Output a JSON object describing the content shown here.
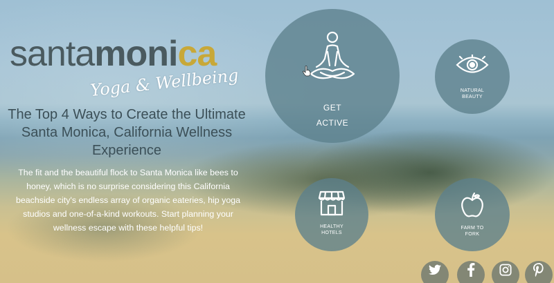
{
  "brand": {
    "logo_santa": "santa",
    "logo_moni": "moni",
    "logo_ca": "ca",
    "tagline": "Yoga & Wellbeing",
    "colors": {
      "logo_gray": "#4a5a5f",
      "logo_gold": "#c8a838"
    }
  },
  "headline": "The Top 4 Ways to Create the Ultimate Santa Monica, California Wellness Experience",
  "intro": "The fit and the beautiful flock to Santa Monica like bees to honey, which is no surprise considering this California beachside city's endless array of organic eateries, hip yoga studios and one-of-a-kind workouts. Start planning your wellness escape with these helpful tips!",
  "circles": {
    "get_active": {
      "line1": "GET",
      "line2": "ACTIVE",
      "icon": "meditation-icon"
    },
    "natural_beauty": {
      "line1": "NATURAL",
      "line2": "BEAUTY",
      "icon": "eye-icon"
    },
    "healthy_hotels": {
      "line1": "HEALTHY",
      "line2": "HOTELS",
      "icon": "storefront-icon"
    },
    "farm_to_fork": {
      "line1": "FARM TO",
      "line2": "FORK",
      "icon": "apple-icon"
    }
  },
  "social": [
    "twitter-icon",
    "facebook-icon",
    "instagram-icon",
    "pinterest-icon"
  ],
  "colors": {
    "circle_fill": "#5c808c",
    "headline": "#3b4f57",
    "social_fill": "#6e7870"
  }
}
